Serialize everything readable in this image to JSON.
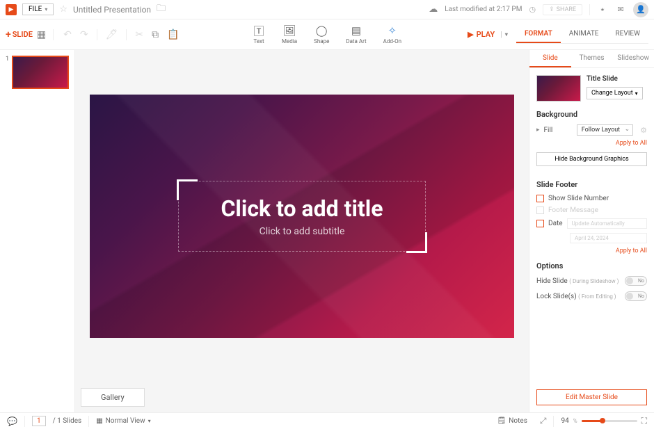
{
  "topbar": {
    "file_label": "FILE",
    "title": "Untitled Presentation",
    "last_modified": "Last modified at 2:17 PM",
    "share_label": "SHARE"
  },
  "toolbar": {
    "add_slide": "SLIDE",
    "center": {
      "text": "Text",
      "media": "Media",
      "shape": "Shape",
      "dataart": "Data Art",
      "addon": "Add-On"
    },
    "play": "PLAY"
  },
  "tabs": {
    "format": "FORMAT",
    "animate": "ANIMATE",
    "review": "REVIEW"
  },
  "subtabs": {
    "slide": "Slide",
    "themes": "Themes",
    "slideshow": "Slideshow"
  },
  "thumbs": [
    {
      "num": "1"
    }
  ],
  "slide": {
    "title_placeholder": "Click to add title",
    "subtitle_placeholder": "Click to add subtitle"
  },
  "panel": {
    "layout_name": "Title Slide",
    "change_layout": "Change Layout",
    "background_hdr": "Background",
    "fill_label": "Fill",
    "fill_value": "Follow Layout",
    "apply_all": "Apply to All",
    "hide_bg": "Hide Background Graphics",
    "footer_hdr": "Slide Footer",
    "show_num": "Show Slide Number",
    "footer_msg": "Footer Message",
    "date_label": "Date",
    "date_mode": "Update Automatically",
    "date_value": "April 24, 2024",
    "options_hdr": "Options",
    "hide_slide": "Hide Slide",
    "hide_slide_sub": "( During Slideshow )",
    "lock_slide": "Lock Slide(s)",
    "lock_slide_sub": "( From Editing )",
    "toggle_off": "No",
    "edit_master": "Edit Master Slide"
  },
  "gallery": "Gallery",
  "status": {
    "page_cur": "1",
    "page_total": "/ 1 Slides",
    "view": "Normal View",
    "notes": "Notes",
    "zoom": "94",
    "zoom_unit": "%"
  }
}
